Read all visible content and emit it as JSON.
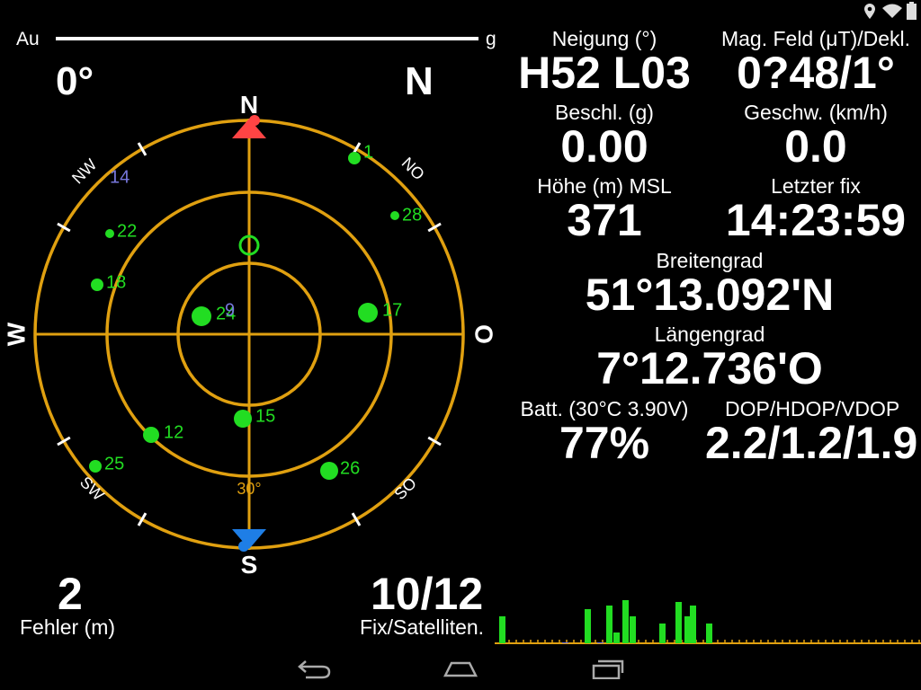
{
  "statusbar": {
    "icons": [
      "location-icon",
      "wifi-icon",
      "battery-icon"
    ]
  },
  "banner": {
    "text_start": "Au",
    "text_end": "g"
  },
  "compass": {
    "heading_deg": "0°",
    "heading_dir": "N",
    "cardinals": {
      "n": "N",
      "e": "O",
      "s": "S",
      "w": "W"
    },
    "intercardinals": {
      "nw": "NW",
      "ne": "NO",
      "sw": "SW",
      "se": "SO"
    },
    "elevation_label": "30°",
    "satellites": [
      {
        "id": "1",
        "color": "#22dd22"
      },
      {
        "id": "14",
        "color": "#7777dd"
      },
      {
        "id": "28",
        "color": "#22dd22"
      },
      {
        "id": "22",
        "color": "#22dd22"
      },
      {
        "id": "18",
        "color": "#22dd22"
      },
      {
        "id": "17",
        "color": "#22dd22"
      },
      {
        "id": "24",
        "color": "#22dd22"
      },
      {
        "id": "9",
        "color": "#7777dd"
      },
      {
        "id": "15",
        "color": "#22dd22"
      },
      {
        "id": "12",
        "color": "#22dd22"
      },
      {
        "id": "25",
        "color": "#22dd22"
      },
      {
        "id": "26",
        "color": "#22dd22"
      }
    ],
    "colors": {
      "ring": "#e0a010",
      "north": "#ff4444",
      "south": "#1e7ee6",
      "sat": "#22dd22",
      "sat_unused": "#7777dd"
    }
  },
  "fields": {
    "tilt": {
      "label": "Neigung (°)",
      "value": "H52 L03"
    },
    "magfield": {
      "label": "Mag. Feld (μT)/Dekl.",
      "value": "0?48/1°"
    },
    "accel": {
      "label": "Beschl. (g)",
      "value": "0.00"
    },
    "speed": {
      "label": "Geschw. (km/h)",
      "value": "0.0"
    },
    "altitude": {
      "label": "Höhe (m) MSL",
      "value": "371"
    },
    "lastfix": {
      "label": "Letzter fix",
      "value": "14:23:59"
    },
    "latitude": {
      "label": "Breitengrad",
      "value": "51°13.092'N"
    },
    "longitude": {
      "label": "Längengrad",
      "value": "7°12.736'O"
    },
    "battery": {
      "label": "Batt. (30°C 3.90V)",
      "value": "77%"
    },
    "dop": {
      "label": "DOP/HDOP/VDOP",
      "value": "2.2/1.2/1.9"
    }
  },
  "bottom": {
    "error_value": "2",
    "error_label": "Fehler (m)",
    "fix_value": "10/12",
    "fix_label": "Fix/Satelliten."
  },
  "signal_bars": [
    {
      "value": 30,
      "color": "#22dd22"
    },
    {
      "value": 0,
      "color": "#e0a010"
    },
    {
      "value": 0,
      "color": "#e0a010"
    },
    {
      "value": 0,
      "color": "#e0a010"
    },
    {
      "value": 0,
      "color": "#e0a010"
    },
    {
      "value": 0,
      "color": "#e0a010"
    },
    {
      "value": 0,
      "color": "#e0a010"
    },
    {
      "value": 0,
      "color": "#e0a010"
    },
    {
      "value": 1,
      "color": "#7777dd"
    },
    {
      "value": 0,
      "color": "#e0a010"
    },
    {
      "value": 38,
      "color": "#22dd22"
    },
    {
      "value": 1,
      "color": "#7777dd"
    },
    {
      "value": 42,
      "color": "#22dd22"
    },
    {
      "value": 12,
      "color": "#22dd22"
    },
    {
      "value": 48,
      "color": "#22dd22"
    },
    {
      "value": 30,
      "color": "#22dd22"
    },
    {
      "value": 0,
      "color": "#e0a010"
    },
    {
      "value": 22,
      "color": "#22dd22"
    },
    {
      "value": 0,
      "color": "#e0a010"
    },
    {
      "value": 46,
      "color": "#22dd22"
    },
    {
      "value": 30,
      "color": "#22dd22"
    },
    {
      "value": 42,
      "color": "#22dd22"
    },
    {
      "value": 0,
      "color": "#e0a010"
    },
    {
      "value": 22,
      "color": "#22dd22"
    }
  ]
}
